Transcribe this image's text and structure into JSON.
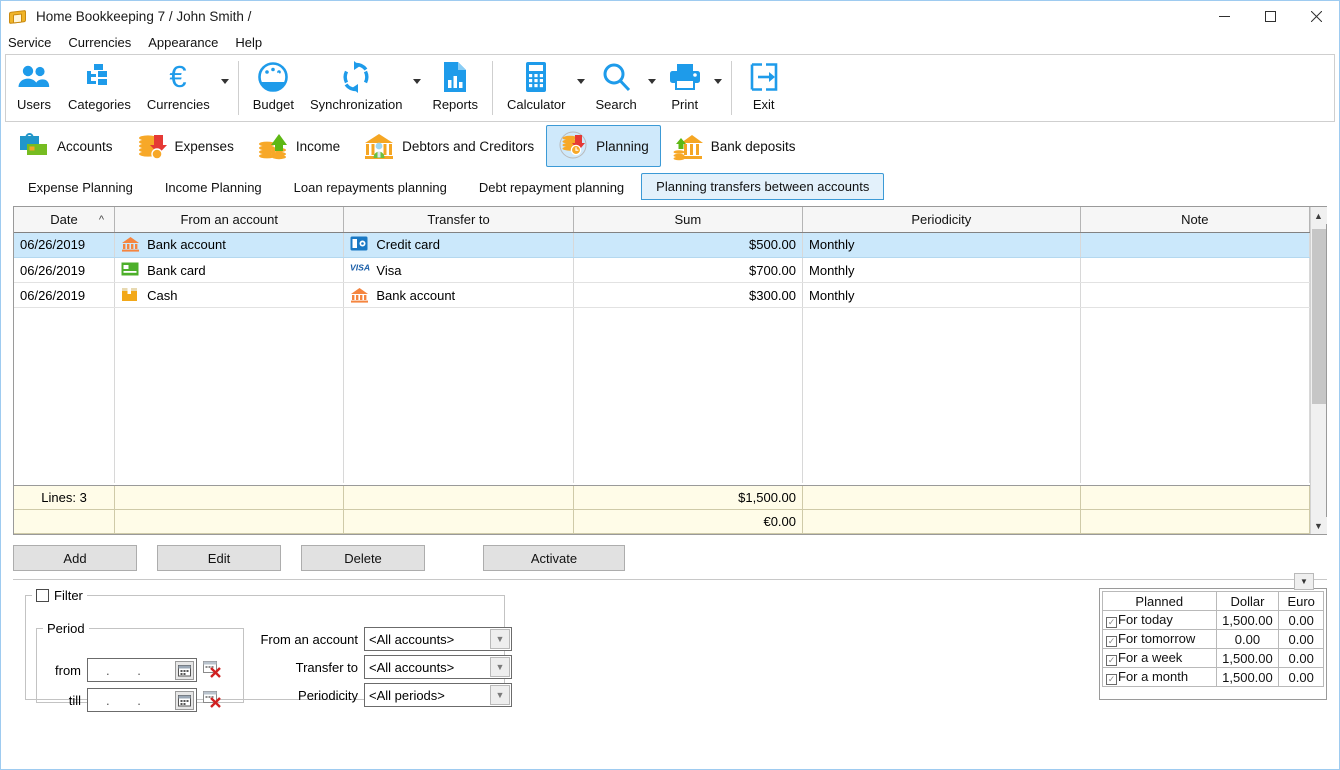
{
  "window": {
    "title": "Home Bookkeeping 7",
    "user": "/ John Smith /",
    "app_icon": "envelope-icon",
    "minimize": "minimize-icon",
    "maximize": "maximize-icon",
    "close": "close-icon"
  },
  "menu": [
    {
      "label": "Service"
    },
    {
      "label": "Currencies"
    },
    {
      "label": "Appearance"
    },
    {
      "label": "Help"
    }
  ],
  "toolbar": {
    "accent": "#1e9bea",
    "groups": [
      {
        "buttons": [
          {
            "label": "Users",
            "icon": "users-icon",
            "dropdown": false
          },
          {
            "label": "Categories",
            "icon": "categories-tree-icon",
            "dropdown": false
          },
          {
            "label": "Currencies",
            "icon": "euro-icon",
            "dropdown": true
          }
        ]
      },
      {
        "buttons": [
          {
            "label": "Budget",
            "icon": "gauge-icon",
            "dropdown": false
          },
          {
            "label": "Synchronization",
            "icon": "sync-icon",
            "dropdown": true
          },
          {
            "label": "Reports",
            "icon": "report-chart-icon",
            "dropdown": false
          }
        ]
      },
      {
        "buttons": [
          {
            "label": "Calculator",
            "icon": "calculator-icon",
            "dropdown": true
          },
          {
            "label": "Search",
            "icon": "search-icon",
            "dropdown": true
          },
          {
            "label": "Print",
            "icon": "printer-icon",
            "dropdown": true
          }
        ]
      },
      {
        "buttons": [
          {
            "label": "Exit",
            "icon": "exit-arrow-icon",
            "dropdown": false
          }
        ]
      }
    ]
  },
  "sections": [
    {
      "label": "Accounts",
      "icon": "wallet-card-icon",
      "active": false
    },
    {
      "label": "Expenses",
      "icon": "coins-down-arrow-icon",
      "active": false
    },
    {
      "label": "Income",
      "icon": "coins-up-arrow-icon",
      "active": false
    },
    {
      "label": "Debtors and Creditors",
      "icon": "bank-person-icon",
      "active": false
    },
    {
      "label": "Planning",
      "icon": "coins-clock-icon",
      "active": true
    },
    {
      "label": "Bank deposits",
      "icon": "bank-up-arrow-icon",
      "active": false
    }
  ],
  "subtabs": [
    {
      "label": "Expense Planning",
      "active": false
    },
    {
      "label": "Income Planning",
      "active": false
    },
    {
      "label": "Loan repayments planning",
      "active": false
    },
    {
      "label": "Debt repayment planning",
      "active": false
    },
    {
      "label": "Planning transfers between accounts",
      "active": true
    }
  ],
  "grid": {
    "columns": [
      {
        "label": "Date",
        "sort": "asc",
        "align": "left"
      },
      {
        "label": "From an account",
        "align": "center"
      },
      {
        "label": "Transfer to",
        "align": "center"
      },
      {
        "label": "Sum",
        "align": "center"
      },
      {
        "label": "Periodicity",
        "align": "center"
      },
      {
        "label": "Note",
        "align": "center"
      }
    ],
    "rows": [
      {
        "date": "06/26/2019",
        "from_account": "Bank account",
        "from_icon": "bank-icon",
        "transfer_to": "Credit card",
        "to_icon": "credit-card-icon",
        "sum": "$500.00",
        "periodicity": "Monthly",
        "note": "",
        "selected": true
      },
      {
        "date": "06/26/2019",
        "from_account": "Bank card",
        "from_icon": "green-card-icon",
        "transfer_to": "Visa",
        "to_icon": "visa-logo-icon",
        "sum": "$700.00",
        "periodicity": "Monthly",
        "note": "",
        "selected": false
      },
      {
        "date": "06/26/2019",
        "from_account": "Cash",
        "from_icon": "cash-box-icon",
        "transfer_to": "Bank account",
        "to_icon": "bank-icon",
        "sum": "$300.00",
        "periodicity": "Monthly",
        "note": "",
        "selected": false
      }
    ],
    "footer": {
      "lines_label": "Lines: 3",
      "total_dollar": "$1,500.00",
      "total_euro": "€0.00"
    },
    "scrollbar": {
      "up": "scroll-up-icon",
      "down": "scroll-down-icon"
    }
  },
  "actions": [
    {
      "label": "Add"
    },
    {
      "label": "Edit"
    },
    {
      "label": "Delete"
    },
    {
      "label": "Activate"
    }
  ],
  "filter": {
    "legend": "Filter",
    "checked": false,
    "period": {
      "legend": "Period",
      "from_label": "from",
      "till_label": "till",
      "from_value": ".  .",
      "till_value": ".  .",
      "calendar_icon": "calendar-icon",
      "clear_icon": "calendar-clear-icon"
    },
    "fields": [
      {
        "label": "From an account",
        "value": "<All accounts>"
      },
      {
        "label": "Transfer to",
        "value": "<All accounts>"
      },
      {
        "label": "Periodicity",
        "value": "<All periods>"
      }
    ]
  },
  "planned_panel": {
    "headers": [
      "Planned",
      "Dollar",
      "Euro"
    ],
    "rows": [
      {
        "label": "For today",
        "checked": true,
        "dollar": "1,500.00",
        "euro": "0.00"
      },
      {
        "label": "For tomorrow",
        "checked": true,
        "dollar": "0.00",
        "euro": "0.00"
      },
      {
        "label": "For a week",
        "checked": true,
        "dollar": "1,500.00",
        "euro": "0.00"
      },
      {
        "label": "For a month",
        "checked": true,
        "dollar": "1,500.00",
        "euro": "0.00"
      }
    ],
    "collapse_button": "scroll-down-icon"
  }
}
